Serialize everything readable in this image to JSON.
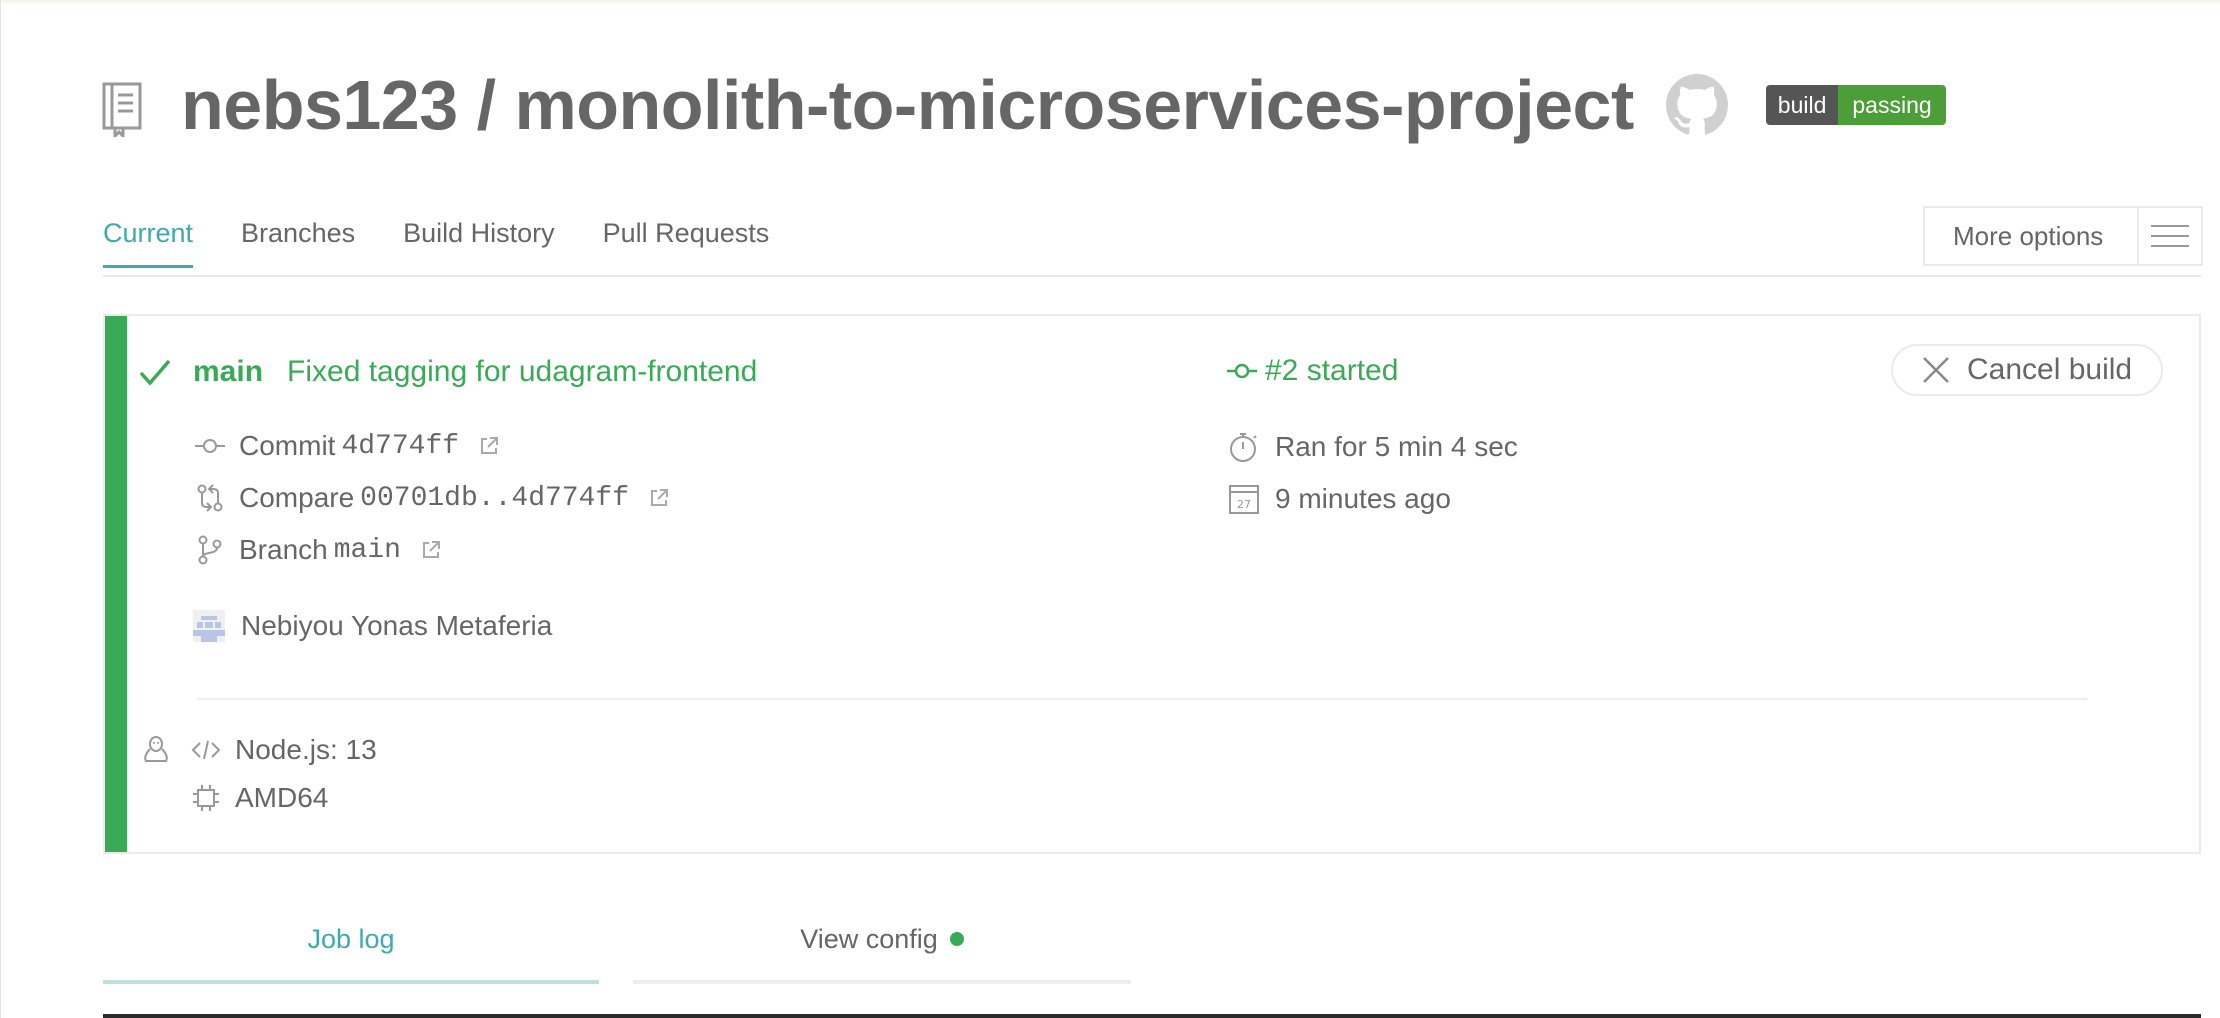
{
  "header": {
    "repo_title": "nebs123 / monolith-to-microservices-project",
    "badge_left": "build",
    "badge_right": "passing",
    "icons": [
      "repo-icon",
      "github-icon"
    ]
  },
  "tabs": [
    "Current",
    "Branches",
    "Build History",
    "Pull Requests"
  ],
  "more_options": "More options",
  "build": {
    "branch": "main",
    "message": "Fixed tagging for udagram-frontend",
    "number_status": "#2 started",
    "cancel_label": "Cancel build",
    "commit_label": "Commit",
    "commit_sha": "4d774ff",
    "compare_label": "Compare",
    "compare_range": "00701db..4d774ff",
    "branch_label": "Branch",
    "branch_value": "main",
    "duration": "Ran for 5 min 4 sec",
    "finished": "9 minutes ago",
    "calendar_day": "27",
    "author": "Nebiyou Yonas Metaferia",
    "language": "Node.js: 13",
    "arch": "AMD64"
  },
  "job_tabs": {
    "log": "Job log",
    "config": "View config"
  },
  "colors": {
    "passing": "#39aa56",
    "accent": "#3eaaaf",
    "badge_dark": "#555555",
    "badge_green": "#4c9f38"
  }
}
